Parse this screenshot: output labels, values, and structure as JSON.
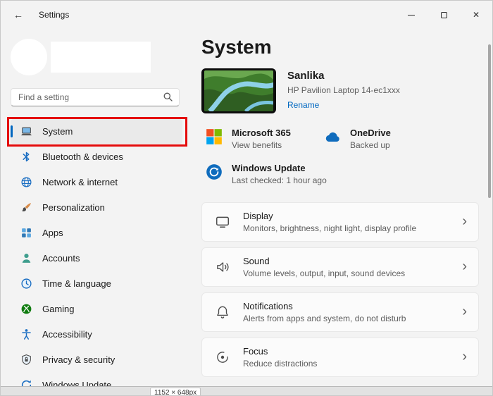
{
  "window": {
    "title": "Settings"
  },
  "icons": {
    "back": "←",
    "close": "✕",
    "chevron": "›"
  },
  "colors": {
    "accent": "#0067c0",
    "annotation_red": "#e40b0b",
    "window_bg": "#f3f3f3",
    "card_bg": "#fbfbfb",
    "selected_item_bg": "#eaeaea"
  },
  "sidebar": {
    "search_placeholder": "Find a setting",
    "items": [
      {
        "label": "System",
        "icon": "system-icon",
        "selected": true
      },
      {
        "label": "Bluetooth & devices",
        "icon": "bluetooth-icon",
        "selected": false
      },
      {
        "label": "Network & internet",
        "icon": "network-icon",
        "selected": false
      },
      {
        "label": "Personalization",
        "icon": "personalization-icon",
        "selected": false
      },
      {
        "label": "Apps",
        "icon": "apps-icon",
        "selected": false
      },
      {
        "label": "Accounts",
        "icon": "accounts-icon",
        "selected": false
      },
      {
        "label": "Time & language",
        "icon": "time-language-icon",
        "selected": false
      },
      {
        "label": "Gaming",
        "icon": "gaming-icon",
        "selected": false
      },
      {
        "label": "Accessibility",
        "icon": "accessibility-icon",
        "selected": false
      },
      {
        "label": "Privacy & security",
        "icon": "privacy-icon",
        "selected": false
      },
      {
        "label": "Windows Update",
        "icon": "windows-update-icon",
        "selected": false
      }
    ]
  },
  "main": {
    "title": "System",
    "device": {
      "name": "Sanlika",
      "model": "HP Pavilion Laptop 14-ec1xxx",
      "rename_label": "Rename"
    },
    "tiles": [
      {
        "title": "Microsoft 365",
        "subtitle": "View benefits",
        "icon": "microsoft-365-icon"
      },
      {
        "title": "OneDrive",
        "subtitle": "Backed up",
        "icon": "onedrive-icon"
      },
      {
        "title": "Windows Update",
        "subtitle": "Last checked: 1 hour ago",
        "icon": "windows-update-icon"
      }
    ],
    "cards": [
      {
        "title": "Display",
        "subtitle": "Monitors, brightness, night light, display profile",
        "icon": "display-icon"
      },
      {
        "title": "Sound",
        "subtitle": "Volume levels, output, input, sound devices",
        "icon": "sound-icon"
      },
      {
        "title": "Notifications",
        "subtitle": "Alerts from apps and system, do not disturb",
        "icon": "notifications-icon"
      },
      {
        "title": "Focus",
        "subtitle": "Reduce distractions",
        "icon": "focus-icon"
      }
    ]
  },
  "statusbar": {
    "size_label": "1152 × 648px"
  }
}
